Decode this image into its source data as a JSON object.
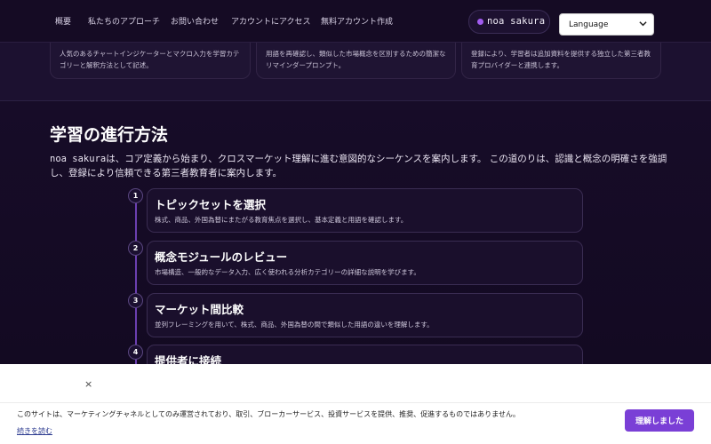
{
  "nav": {
    "links": [
      "概要",
      "私たちのアプローチ",
      "お問い合わせ",
      "アカウントにアクセス",
      "無料アカウント作成"
    ],
    "brand": "noa sakura",
    "language_label": "Language"
  },
  "cards": [
    "人気のあるチャートインジケーターとマクロ入力を学習カテゴリーと解釈方法として記述。",
    "用語を再確認し、類似した市場概念を区別するための簡潔なリマインダープロンプト。",
    "登録により、学習者は追加資料を提供する独立した第三者教育プロバイダーと連携します。"
  ],
  "section": {
    "title": "学習の進行方法",
    "intro_brand": "noa sakura",
    "intro_rest": "は、コア定義から始まり、クロスマーケット理解に進む意図的なシーケンスを案内します。 この道のりは、認識と概念の明確さを強調し、登録により信頼できる第三者教育者に案内します。",
    "steps": [
      {
        "num": "1",
        "title": "トピックセットを選択",
        "desc": "株式、商品、外国為替にまたがる教育焦点を選択し、基本定義と用語を確認します。"
      },
      {
        "num": "2",
        "title": "概念モジュールのレビュー",
        "desc": "市場構造、一般的なデータ入力、広く使われる分析カテゴリーの詳細な説明を学びます。"
      },
      {
        "num": "3",
        "title": "マーケット間比較",
        "desc": "並列フレーミングを用いて、株式、商品、外国為替の間で類似した用語の違いを理解します。"
      },
      {
        "num": "4",
        "title": "提供者に接続",
        "desc": ""
      }
    ]
  },
  "cookie": {
    "close": "×",
    "text": "このサイトは、マーケティングチャネルとしてのみ運営されており、取引、ブローカーサービス、投資サービスを提供、推奨、促進するものではありません。",
    "link": "続きを読む",
    "button": "理解しました"
  }
}
